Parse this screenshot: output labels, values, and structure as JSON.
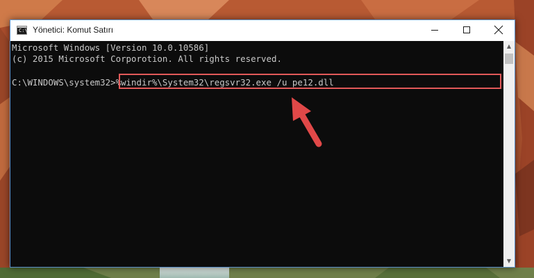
{
  "window": {
    "title": "Yönetici: Komut Satırı",
    "icon_label": "C:\\"
  },
  "console": {
    "lines": [
      "Microsoft Windows [Version 10.0.10586]",
      "(c) 2015 Microsoft Corporotion. All rights reserved.",
      "",
      "C:\\WINDOWS\\system32>%windir%\\System32\\regsvr32.exe /u pe12.dll"
    ]
  },
  "icons": {
    "app": "cmd-icon",
    "minimize": "minimize-icon",
    "maximize": "maximize-icon",
    "close": "close-icon",
    "annotation": "red-arrow-icon"
  },
  "colors": {
    "console_bg": "#0c0c0c",
    "console_text": "#c8c8c8",
    "highlight": "#e25959",
    "window_border": "#5b8fc9"
  }
}
